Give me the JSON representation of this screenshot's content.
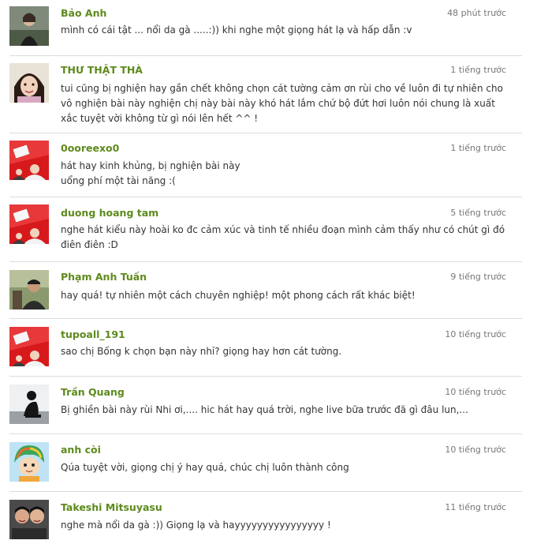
{
  "comments": [
    {
      "name": "Bảo Anh",
      "time": "48 phút trước",
      "text": "mình có cái tật ... nổi da gà .....:)) khi nghe một giọng hát lạ và hấp dẫn :v",
      "avatar": "photo-girl-icon"
    },
    {
      "name": "THƯ THẬT THÀ",
      "time": "1 tiếng trước",
      "text": "tui cũng bị nghiện hay gần chết không chọn cát tường cảm ơn rùi cho về luôn đi tự nhiên cho vô nghiện bài này nghiện chị này bài này khó hát lắm chứ bộ đứt hơi luôn nói chung là xuất xắc tuyệt vời không từ gì nói lên hết ^^ !",
      "avatar": "photo-girl-icon"
    },
    {
      "name": "0ooreexo0",
      "time": "1 tiếng trước",
      "text": "hát hay kinh khủng, bị nghiện bài này\nuổng phí một tài năng :(",
      "avatar": "default-red-avatar-icon"
    },
    {
      "name": "duong hoang tam",
      "time": "5 tiếng trước",
      "text": "nghe hát kiểu này hoài ko đc cảm xúc và tinh tế nhiều đoạn mình cảm thấy như có chút gì đó điên điên :D",
      "avatar": "default-red-avatar-icon"
    },
    {
      "name": "Phạm Anh Tuấn",
      "time": "9 tiếng trước",
      "text": "hay quá! tự nhiên một cách chuyên nghiệp! một phong cách rất khác biệt!",
      "avatar": "photo-man-icon"
    },
    {
      "name": "tupoall_191",
      "time": "10 tiếng trước",
      "text": "sao chị Bống k chọn bạn này nhỉ? giọng hay hơn cát tường.",
      "avatar": "default-red-avatar-icon"
    },
    {
      "name": "Trần Quang",
      "time": "10 tiếng trước",
      "text": "Bị ghiền bài này rùi Nhi ơi,.... hic hát hay quá trời, nghe live bữa trước đã gì đâu lun,...",
      "avatar": "photo-silhouette-icon"
    },
    {
      "name": "anh còi",
      "time": "10 tiếng trước",
      "text": "Qúa tuyệt vời, giọng chị ý hay quá, chúc chị luôn thành công",
      "avatar": "cartoon-boy-icon"
    },
    {
      "name": "Takeshi Mitsuyasu",
      "time": "11 tiếng trước",
      "text": "nghe mà nổi da gà :)) Giọng lạ và hayyyyyyyyyyyyyyyy !",
      "avatar": "photo-two-people-icon"
    }
  ]
}
